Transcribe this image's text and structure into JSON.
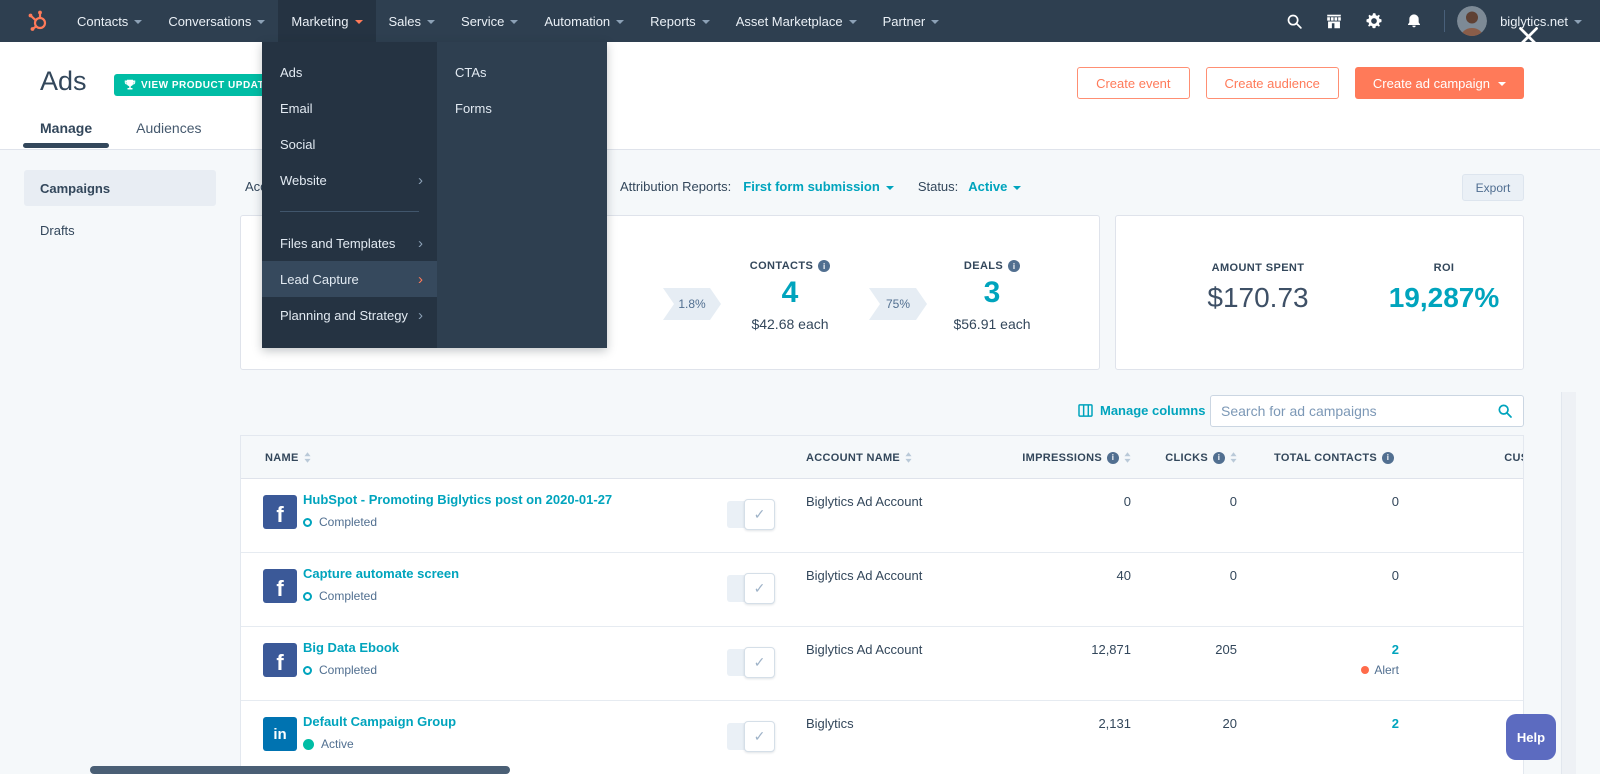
{
  "nav": {
    "brand": "HubSpot",
    "items": [
      {
        "label": "Contacts"
      },
      {
        "label": "Conversations"
      },
      {
        "label": "Marketing"
      },
      {
        "label": "Sales"
      },
      {
        "label": "Service"
      },
      {
        "label": "Automation"
      },
      {
        "label": "Reports"
      },
      {
        "label": "Asset Marketplace"
      },
      {
        "label": "Partner"
      }
    ],
    "account": "biglytics.net"
  },
  "menu": {
    "items": [
      {
        "label": "Ads"
      },
      {
        "label": "Email"
      },
      {
        "label": "Social"
      },
      {
        "label": "Website"
      },
      {
        "label": "Files and Templates"
      },
      {
        "label": "Lead Capture"
      },
      {
        "label": "Planning and Strategy"
      }
    ],
    "submenu": [
      {
        "label": "CTAs"
      },
      {
        "label": "Forms"
      }
    ]
  },
  "header": {
    "title": "Ads",
    "badge": "VIEW PRODUCT UPDATES",
    "buttons": [
      {
        "label": "Create event"
      },
      {
        "label": "Create audience"
      },
      {
        "label": "Create ad campaign"
      }
    ],
    "tabs": [
      {
        "label": "Manage"
      },
      {
        "label": "Audiences"
      }
    ]
  },
  "sidebar": {
    "items": [
      {
        "label": "Campaigns"
      },
      {
        "label": "Drafts"
      }
    ]
  },
  "filters": {
    "account_label": "Account:",
    "attribution_label": "Attribution Reports:",
    "attribution_value": "First form submission",
    "status_label": "Status:",
    "status_value": "Active",
    "export_label": "Export"
  },
  "funnel": {
    "stages": [
      {
        "rate": "1.8%",
        "label": "CONTACTS",
        "value": "4",
        "sub": "$42.68 each"
      },
      {
        "rate": "75%",
        "label": "DEALS",
        "value": "3",
        "sub": "$56.91 each"
      }
    ]
  },
  "summary": {
    "spent_label": "AMOUNT SPENT",
    "spent_value": "$170.73",
    "roi_label": "ROI",
    "roi_value": "19,287%"
  },
  "controls": {
    "manage_columns": "Manage columns",
    "search_placeholder": "Search for ad campaigns"
  },
  "table": {
    "columns": [
      {
        "label": "NAME"
      },
      {
        "label": "ACCOUNT NAME"
      },
      {
        "label": "IMPRESSIONS"
      },
      {
        "label": "CLICKS"
      },
      {
        "label": "TOTAL CONTACTS"
      },
      {
        "label": "CUSTOMERS"
      }
    ],
    "rows": [
      {
        "network": "facebook",
        "name": "HubSpot - Promoting Biglytics post on 2020-01-27",
        "status": "Completed",
        "account": "Biglytics Ad Account",
        "impressions": "0",
        "clicks": "0",
        "contacts": "0"
      },
      {
        "network": "facebook",
        "name": "Capture automate screen",
        "status": "Completed",
        "account": "Biglytics Ad Account",
        "impressions": "40",
        "clicks": "0",
        "contacts": "0"
      },
      {
        "network": "facebook",
        "name": "Big Data Ebook",
        "status": "Completed",
        "account": "Biglytics Ad Account",
        "impressions": "12,871",
        "clicks": "205",
        "contacts": "2",
        "alert": "Alert"
      },
      {
        "network": "linkedin",
        "name": "Default Campaign Group",
        "status": "Active",
        "account": "Biglytics",
        "impressions": "2,131",
        "clicks": "20",
        "contacts": "2"
      }
    ]
  },
  "help_label": "Help",
  "colors": {
    "brand_orange": "#ff7a59",
    "link_teal": "#00a4bd",
    "badge_teal": "#00bda5",
    "nav_dark": "#2e3f50"
  }
}
